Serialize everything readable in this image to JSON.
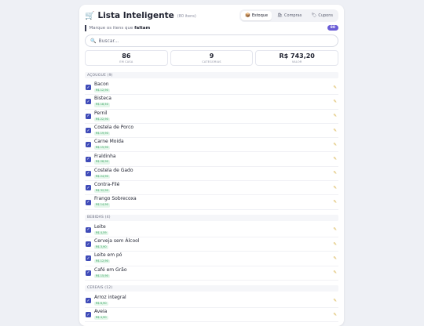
{
  "app": {
    "title": "Lista Inteligente",
    "items_count": "(80 itens)"
  },
  "tabs": [
    {
      "icon": "📦",
      "label": "Estoque",
      "active": true
    },
    {
      "icon": "🛍",
      "label": "Compras",
      "active": false
    },
    {
      "icon": "🏷",
      "label": "Cupons",
      "active": false
    }
  ],
  "hint": {
    "prefix": "Marque os itens que ",
    "emphasis": "faltam",
    "badge": "80"
  },
  "search": {
    "placeholder": "Buscar..."
  },
  "stats": [
    {
      "value": "86",
      "label": "EM CASA"
    },
    {
      "value": "9",
      "label": "CATEGORIAS"
    },
    {
      "value": "R$ 743,20",
      "label": "VALOR"
    }
  ],
  "categories": [
    {
      "title": "AÇOUGUE (9)",
      "items": [
        {
          "name": "Bacon",
          "price": "R$ 12,90"
        },
        {
          "name": "Bisteca",
          "price": "R$ 18,50"
        },
        {
          "name": "Pernil",
          "price": "R$ 22,90"
        },
        {
          "name": "Costela de Porco",
          "price": "R$ 19,90"
        },
        {
          "name": "Carne Moida",
          "price": "R$ 15,90"
        },
        {
          "name": "Fraldinha",
          "price": "R$ 28,90"
        },
        {
          "name": "Costela de Gado",
          "price": "R$ 24,90"
        },
        {
          "name": "Contra-Filé",
          "price": "R$ 32,90"
        },
        {
          "name": "Frango Sobrecoxa",
          "price": "R$ 14,90"
        }
      ]
    },
    {
      "title": "BEBIDAS (4)",
      "items": [
        {
          "name": "Leite",
          "price": "R$ 4,59"
        },
        {
          "name": "Cerveja sem Álcool",
          "price": "R$ 3,90"
        },
        {
          "name": "Leite em pó",
          "price": "R$ 12,90"
        },
        {
          "name": "Café em Grão",
          "price": "R$ 15,90"
        }
      ]
    },
    {
      "title": "CEREAIS (12)",
      "items": [
        {
          "name": "Arroz integral",
          "price": "R$ 6,90"
        },
        {
          "name": "Aveia",
          "price": "R$ 4,90"
        }
      ]
    }
  ]
}
